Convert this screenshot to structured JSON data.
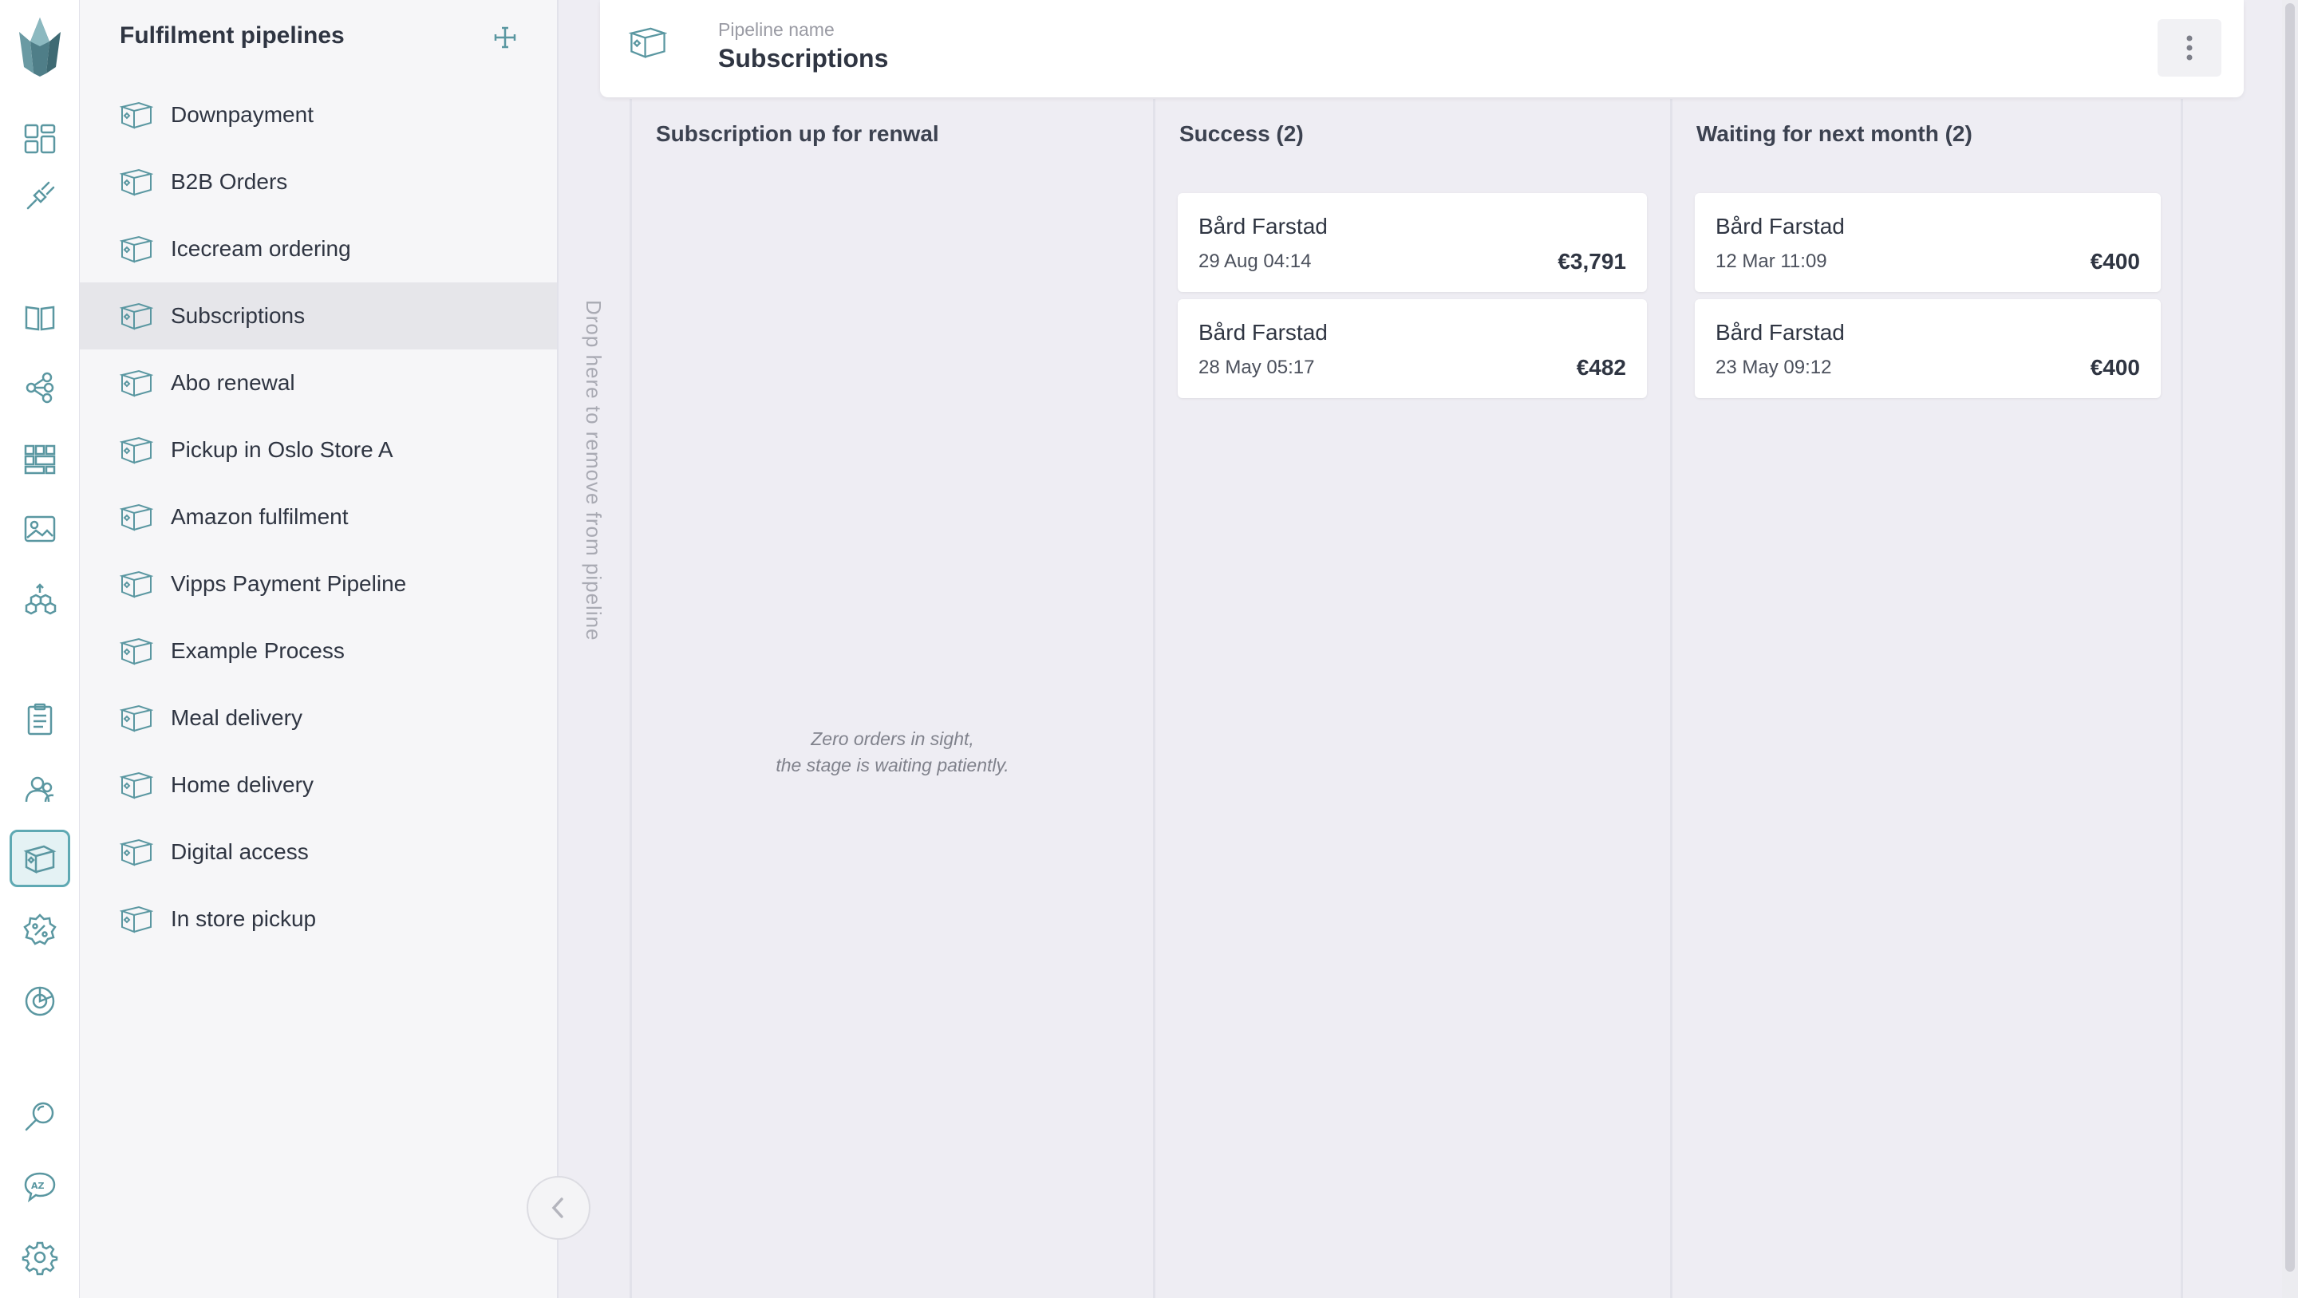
{
  "rail": {
    "icons": [
      "dashboard-icon",
      "plug-icon",
      "catalogue-icon",
      "topics-icon",
      "grid-icon",
      "image-icon",
      "shapes-icon",
      "orders-icon",
      "customers-icon",
      "fulfilment-icon",
      "discount-icon",
      "reports-icon",
      "search-icon",
      "translation-icon",
      "settings-icon"
    ],
    "active": "fulfilment-icon",
    "accent_color": "#5fa9b3"
  },
  "sidebar": {
    "title": "Fulfilment pipelines",
    "items": [
      {
        "label": "Downpayment"
      },
      {
        "label": "B2B Orders"
      },
      {
        "label": "Icecream ordering"
      },
      {
        "label": "Subscriptions",
        "selected": true
      },
      {
        "label": "Abo renewal"
      },
      {
        "label": "Pickup in Oslo Store A"
      },
      {
        "label": "Amazon fulfilment"
      },
      {
        "label": "Vipps Payment Pipeline"
      },
      {
        "label": "Example Process"
      },
      {
        "label": "Meal delivery"
      },
      {
        "label": "Home delivery"
      },
      {
        "label": "Digital access"
      },
      {
        "label": "In store pickup"
      }
    ]
  },
  "header": {
    "label": "Pipeline name",
    "title": "Subscriptions"
  },
  "drop_zone": {
    "text": "Drop here to remove from pipeline"
  },
  "stages": [
    {
      "title": "Subscription up for renwal",
      "empty_line1": "Zero orders in sight,",
      "empty_line2": "the stage is waiting patiently.",
      "orders": []
    },
    {
      "title": "Success (2)",
      "orders": [
        {
          "name": "Bård Farstad",
          "date": "29 Aug 04:14",
          "amount": "€3,791"
        },
        {
          "name": "Bård Farstad",
          "date": "28 May 05:17",
          "amount": "€482"
        }
      ]
    },
    {
      "title": "Waiting for next month (2)",
      "orders": [
        {
          "name": "Bård Farstad",
          "date": "12 Mar 11:09",
          "amount": "€400"
        },
        {
          "name": "Bård Farstad",
          "date": "23 May 09:12",
          "amount": "€400"
        }
      ]
    }
  ]
}
